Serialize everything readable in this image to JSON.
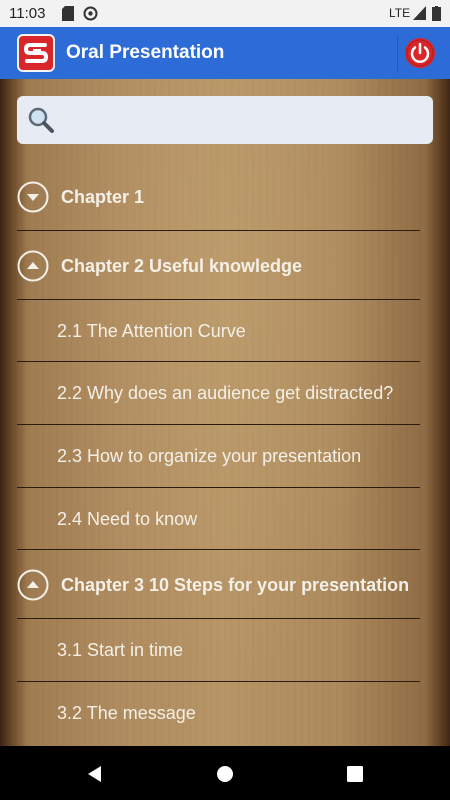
{
  "status_bar": {
    "time": "11:03",
    "network": "LTE"
  },
  "app_bar": {
    "title": "Oral Presentation",
    "brand_color": "#2d6bd6",
    "power_color": "#d8262b"
  },
  "search": {
    "value": "",
    "placeholder": ""
  },
  "items": [
    {
      "type": "chapter",
      "label": "Chapter 1",
      "expanded": false
    },
    {
      "type": "chapter",
      "label": "Chapter 2 Useful knowledge",
      "expanded": true
    },
    {
      "type": "section",
      "label": "2.1 The Attention Curve"
    },
    {
      "type": "section",
      "label": "2.2 Why does an audience get distracted?"
    },
    {
      "type": "section",
      "label": "2.3 How to organize your presentation"
    },
    {
      "type": "section",
      "label": "2.4 Need to know"
    },
    {
      "type": "chapter",
      "label": "Chapter 3 10 Steps for your presentation",
      "expanded": true
    },
    {
      "type": "section",
      "label": "3.1 Start in time"
    },
    {
      "type": "section",
      "label": "3.2 The message"
    }
  ],
  "icons": {
    "search": "search-icon",
    "collapsed": "chevron-down-circle-icon",
    "expanded": "chevron-up-circle-icon",
    "back": "back-triangle-icon",
    "home": "home-circle-icon",
    "recents": "recents-square-icon"
  }
}
